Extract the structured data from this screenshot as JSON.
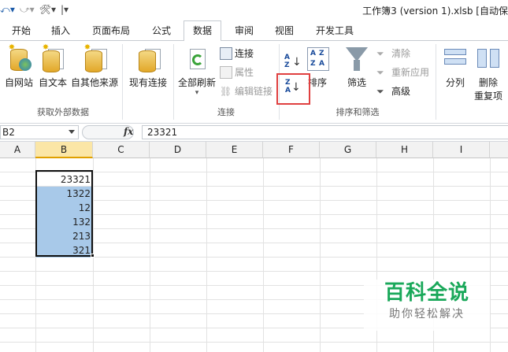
{
  "window": {
    "title": "工作簿3 (version 1).xlsb [自动保"
  },
  "tabs": [
    {
      "label": "开始"
    },
    {
      "label": "插入"
    },
    {
      "label": "页面布局"
    },
    {
      "label": "公式"
    },
    {
      "label": "数据"
    },
    {
      "label": "审阅"
    },
    {
      "label": "视图"
    },
    {
      "label": "开发工具"
    }
  ],
  "ribbon": {
    "get_external": {
      "label": "获取外部数据",
      "from_web": "自网站",
      "from_text": "自文本",
      "from_other": "自其他来源",
      "existing": "现有连接"
    },
    "connections": {
      "label": "连接",
      "refresh_all": "全部刷新",
      "connections": "连接",
      "properties": "属性",
      "edit_links": "编辑链接"
    },
    "sort_filter": {
      "label": "排序和筛选",
      "sort": "排序",
      "filter": "筛选",
      "clear": "清除",
      "reapply": "重新应用",
      "advanced": "高级"
    },
    "data_tools": {
      "text_to_columns": "分列",
      "remove_dup": "删除",
      "remove_dup_2": "重复项"
    }
  },
  "formula_bar": {
    "name_box": "B2",
    "fx": "fx",
    "value": "23321"
  },
  "columns": [
    "A",
    "B",
    "C",
    "D",
    "E",
    "F",
    "G",
    "H",
    "I"
  ],
  "cells": [
    "23321",
    "1322",
    "12",
    "132",
    "213",
    "321"
  ],
  "watermark": {
    "title": "百科全说",
    "subtitle": "助你轻松解决"
  },
  "colors": {
    "accent": "#1aa85a",
    "selection": "#a8c9e9",
    "highlight_box": "#e04040"
  }
}
